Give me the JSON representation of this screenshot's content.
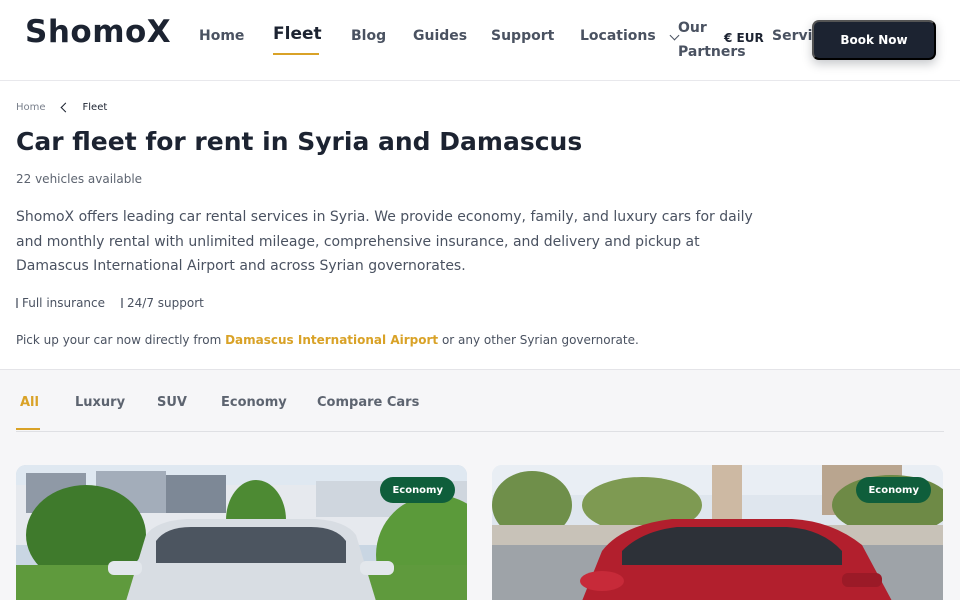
{
  "header": {
    "logo": "ShomoX",
    "nav": {
      "home": "Home",
      "fleet": "Fleet",
      "blog": "Blog",
      "guides": "Guides",
      "support": "Support",
      "locations": "Locations",
      "partners_line1": "Our",
      "partners_line2": "Partners",
      "services": "Servic"
    },
    "currency": "€ EUR",
    "book_button": "Book Now"
  },
  "breadcrumb": {
    "home": "Home",
    "current": "Fleet"
  },
  "page": {
    "title": "Car fleet for rent in Syria and Damascus",
    "vehicle_count": "22 vehicles available",
    "intro": "ShomoX offers leading car rental services in Syria. We provide economy, family, and luxury cars for daily and monthly rental with unlimited mileage, comprehensive insurance, and delivery and pickup at Damascus International Airport and across Syrian governorates.",
    "features": [
      "Full insurance",
      "24/7 support"
    ],
    "pickup_before": "Pick up your car now directly from ",
    "pickup_link": "Damascus International Airport",
    "pickup_after": " or any other Syrian governorate."
  },
  "tabs": [
    {
      "label": "All",
      "active": true
    },
    {
      "label": "Luxury",
      "active": false
    },
    {
      "label": "SUV",
      "active": false
    },
    {
      "label": "Economy",
      "active": false
    },
    {
      "label": "Compare Cars",
      "active": false
    }
  ],
  "cards": [
    {
      "badge": "Economy",
      "car_color": "silver"
    },
    {
      "badge": "Economy",
      "car_color": "red"
    }
  ],
  "colors": {
    "brand_dark": "#1c2331",
    "accent": "#d9a227",
    "badge_green": "#0f5e3b"
  },
  "icons": {
    "locations_chevron": "chevron-down-icon",
    "partners_chevron": "chevron-down-icon",
    "breadcrumb_separator": "chevron-left-icon",
    "feature": "check-icon"
  }
}
